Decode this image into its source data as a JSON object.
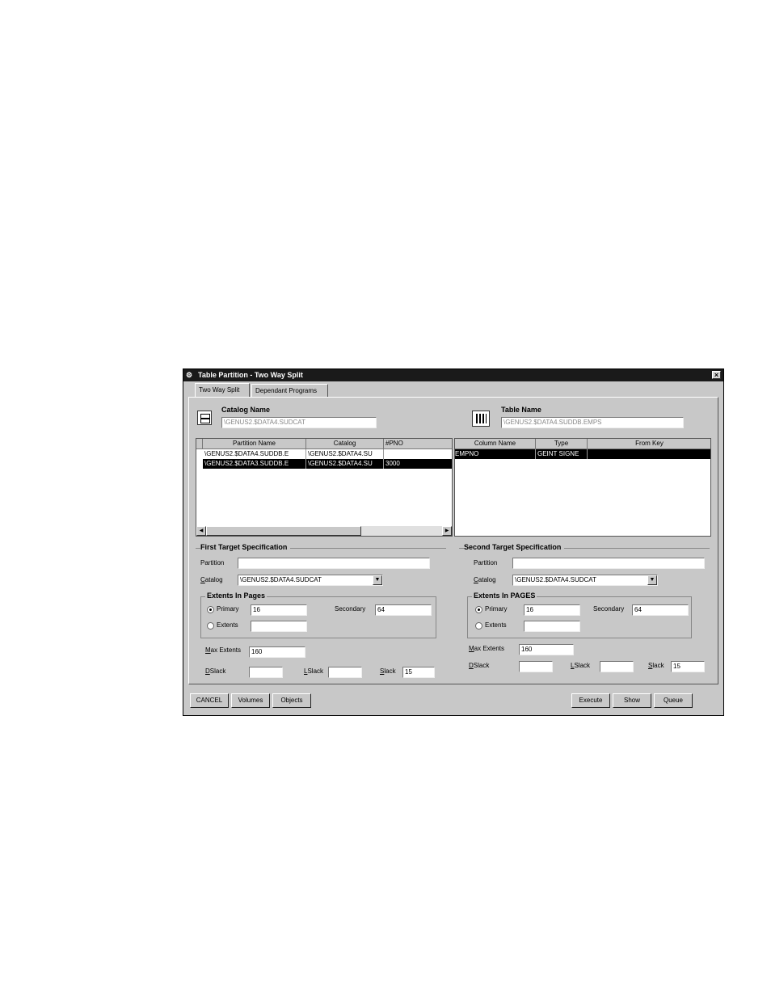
{
  "window": {
    "title": "Table Partition - Two Way Split",
    "close_label": "×"
  },
  "tabs": [
    {
      "label": "Two Way Split",
      "active": true
    },
    {
      "label": "Dependant Programs",
      "active": false
    }
  ],
  "catalog": {
    "label": "Catalog Name",
    "value": "\\GENUS2.$DATA4.SUDCAT"
  },
  "table": {
    "label": "Table Name",
    "value": "\\GENUS2.$DATA4.SUDDB.EMPS"
  },
  "partitions_grid": {
    "headers": [
      "Partition Name",
      "Catalog",
      "#PNO"
    ],
    "rows": [
      [
        "\\GENUS2.$DATA4.SUDDB.E",
        "\\GENUS2.$DATA4.SU",
        ""
      ],
      [
        "\\GENUS2.$DATA3.SUDDB.E",
        "\\GENUS2.$DATA4.SU",
        "3000"
      ]
    ],
    "selected_row": 1
  },
  "columns_grid": {
    "headers": [
      "Column Name",
      "Type",
      "From Key"
    ],
    "rows": [
      [
        "EMPNO",
        "GEINT SIGNE",
        ""
      ]
    ],
    "selected_row": 0
  },
  "first_target": {
    "title": "First Target Specification",
    "partition_label": "Partition",
    "partition_value": "",
    "catalog_label": "Catalog",
    "catalog_value": "\\GENUS2.$DATA4.SUDCAT",
    "extents_title": "Extents In Pages",
    "primary_label": "Primary",
    "primary_value": "16",
    "extents_label": "Extents",
    "extents_value": "",
    "secondary_label": "Secondary",
    "secondary_value": "64",
    "max_extents_label": "Max Extents",
    "max_extents_value": "160",
    "dslack_label": "DSlack",
    "dslack_value": "",
    "lslack_label": "LSlack",
    "lslack_value": "",
    "slack_label": "Slack",
    "slack_value": "15"
  },
  "second_target": {
    "title": "Second Target Specification",
    "partition_label": "Partition",
    "partition_value": "",
    "catalog_label": "Catalog",
    "catalog_value": "\\GENUS2.$DATA4.SUDCAT",
    "extents_title": "Extents In PAGES",
    "primary_label": "Primary",
    "primary_value": "16",
    "extents_label": "Extents",
    "extents_value": "",
    "secondary_label": "Secondary",
    "secondary_value": "64",
    "max_extents_label": "Max Extents",
    "max_extents_value": "160",
    "dslack_label": "DSlack",
    "dslack_value": "",
    "lslack_label": "LSlack",
    "lslack_value": "",
    "slack_label": "Slack",
    "slack_value": "15"
  },
  "buttons": {
    "cancel": "CANCEL",
    "volumes": "Volumes",
    "objects": "Objects",
    "execute": "Execute",
    "show": "Show",
    "queue": "Queue"
  },
  "icons": {
    "catalog": "cabinet-icon",
    "table": "table-grid-icon",
    "window": "app-icon"
  }
}
